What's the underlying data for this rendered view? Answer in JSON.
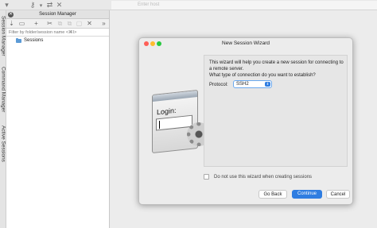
{
  "toolbar": {
    "host_placeholder": "Enter host",
    "icons": [
      "dropdown-arrow-icon",
      "key-icon",
      "chevron-down-icon",
      "transfer-icon",
      "disconnect-icon"
    ]
  },
  "vtabs": [
    "Session Manager",
    "Command Manager",
    "Active Sessions"
  ],
  "session_manager": {
    "title": "Session Manager",
    "close_glyph": "✕",
    "tool_glyphs": [
      "⇣",
      "▭",
      "+",
      "✂",
      "⧉",
      "⧉",
      "▢",
      "✕",
      "»"
    ],
    "filter_placeholder": "Filter by folder/session name <⌘I>",
    "items": [
      {
        "label": "Sessions"
      }
    ]
  },
  "dialog": {
    "title": "New Session Wizard",
    "description": "This wizard will help you create a new session for connecting to a remote server.",
    "question": "What type of connection do you want to establish?",
    "protocol_label": "Protocol:",
    "protocol_value": "SSH2",
    "illustration_text": "Login:",
    "checkbox_label": "Do not use this wizard when creating sessions",
    "buttons": {
      "back": "Go Back",
      "continue": "Continue",
      "cancel": "Cancel"
    },
    "traffic_lights": {
      "close": "#fe5f57",
      "minimize": "#febc2e",
      "zoom": "#28c840"
    }
  },
  "colors": {
    "accent": "#2f7de1",
    "folder": "#5b9ad6"
  }
}
